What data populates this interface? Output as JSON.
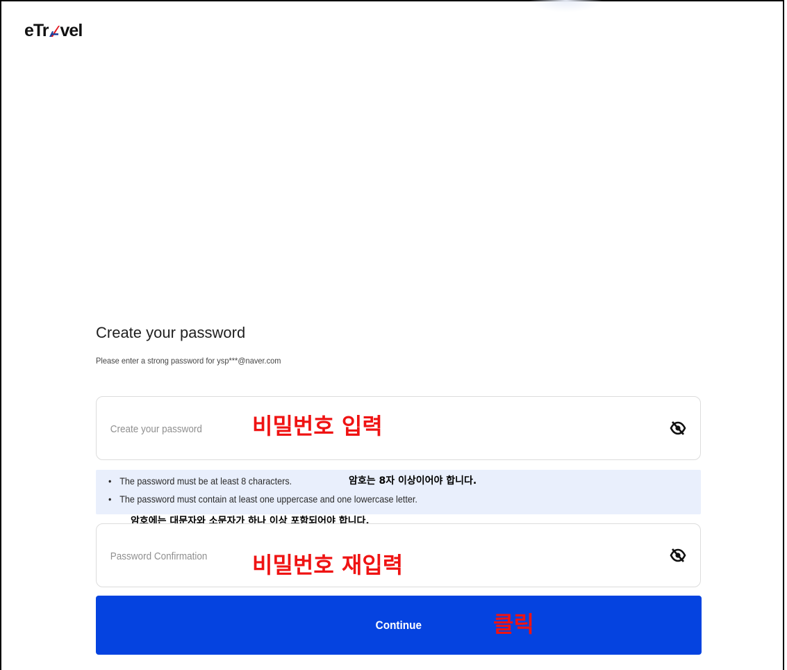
{
  "brand": {
    "logo_left": "eTr",
    "logo_right": "vel"
  },
  "heading": {
    "title": "Create your password",
    "subtitle": "Please enter a strong password for ysp***@naver.com"
  },
  "password_field": {
    "placeholder": "Create your password",
    "value": "",
    "toggle_icon": "eye-off-icon",
    "annotation": "비밀번호 입력"
  },
  "requirements": {
    "items": [
      {
        "text": "The password must be at least 8 characters.",
        "annotation": "암호는 8자 이상이어야 합니다."
      },
      {
        "text": "The password must contain at least one uppercase and one lowercase letter.",
        "annotation": "암호에는 대문자와 소문자가 하나 이상 포함되어야 합니다."
      }
    ],
    "bullet": "•"
  },
  "confirm_field": {
    "placeholder": "Password Confirmation",
    "value": "",
    "toggle_icon": "eye-off-icon",
    "annotation": "비밀번호 재입력"
  },
  "continue_button": {
    "label": "Continue",
    "annotation": "클릭"
  },
  "colors": {
    "primary": "#0543e0",
    "annotation_red": "#ef1313",
    "hint_bg": "#e9effc",
    "logo_accent": "#e31b23",
    "logo_accent_2": "#1c3f9b"
  }
}
